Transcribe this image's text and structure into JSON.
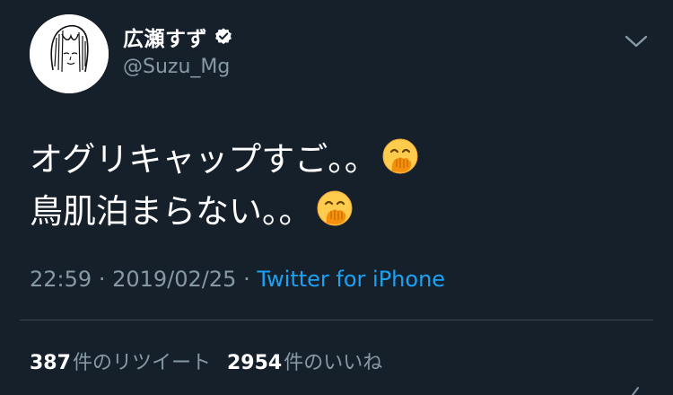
{
  "user": {
    "display_name": "広瀬すず",
    "handle": "@Suzu_Mg",
    "verified": true
  },
  "icons": {
    "avatar": "avatar-drawing",
    "verified": "verified-badge-icon",
    "menu": "chevron-down-icon",
    "emoji": "face-with-hand-over-mouth-emoji"
  },
  "tweet": {
    "lines": [
      "オグリキャップすご。。",
      "鳥肌泊まらない。。"
    ],
    "time": "22:59",
    "separator": "·",
    "date": "2019/02/25",
    "source": "Twitter for iPhone"
  },
  "stats": {
    "retweets": {
      "count": "387",
      "label": "件のリツイート"
    },
    "likes": {
      "count": "2954",
      "label": "件のいいね"
    }
  },
  "colors": {
    "background": "#15202b",
    "text": "#ffffff",
    "secondary": "#8899a6",
    "link": "#1da1f2",
    "divider": "#38444d"
  }
}
